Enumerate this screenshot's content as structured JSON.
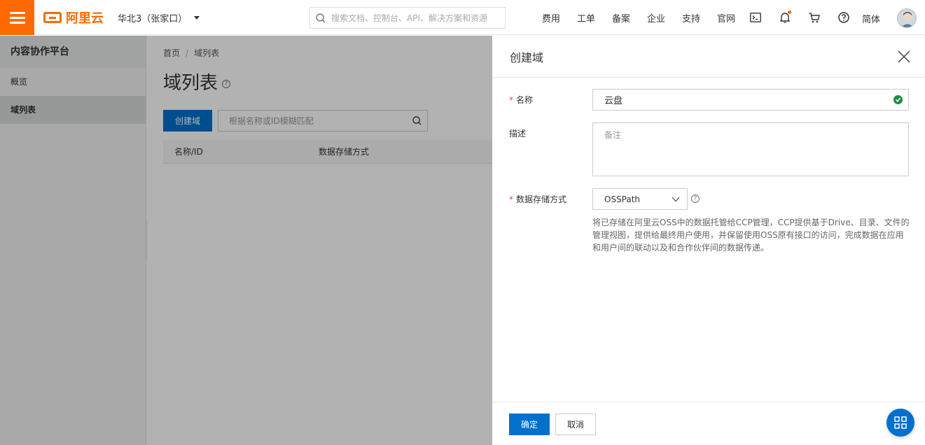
{
  "topbar": {
    "logo_text": "阿里云",
    "region": "华北3（张家口）",
    "search_placeholder": "搜索文档、控制台、API、解决方案和资源",
    "nav": [
      "费用",
      "工单",
      "备案",
      "企业",
      "支持",
      "官网"
    ],
    "icons": [
      "terminal-icon",
      "bell-icon",
      "cart-icon",
      "help-icon"
    ],
    "language": "简体"
  },
  "sidebar": {
    "title": "内容协作平台",
    "items": [
      {
        "label": "概览",
        "active": false
      },
      {
        "label": "域列表",
        "active": true
      }
    ]
  },
  "main": {
    "breadcrumb": [
      "首页",
      "域列表"
    ],
    "breadcrumb_sep": "/",
    "title": "域列表",
    "help_glyph": "?",
    "create_label": "创建域",
    "search_placeholder": "根据名称或ID模糊匹配",
    "columns": [
      "名称/ID",
      "数据存储方式"
    ]
  },
  "drawer": {
    "title": "创建域",
    "name_label": "名称",
    "name_value": "云盘",
    "desc_label": "描述",
    "desc_placeholder": "备注",
    "storage_label": "数据存储方式",
    "storage_value": "OSSPath",
    "storage_help_glyph": "?",
    "storage_desc": "将已存储在阿里云OSS中的数据托管给CCP管理，CCP提供基于Drive、目录、文件的管理视图，提供给最终用户使用，并保留使用OSS原有接口的访问，完成数据在应用和用户间的联动以及和合作伙伴间的数据传递。",
    "required_mark": "*",
    "ok_label": "确定",
    "cancel_label": "取消"
  },
  "colors": {
    "brand": "#ff6a00",
    "primary": "#0070cc",
    "success": "#1e8e3e",
    "required": "#e84738"
  }
}
